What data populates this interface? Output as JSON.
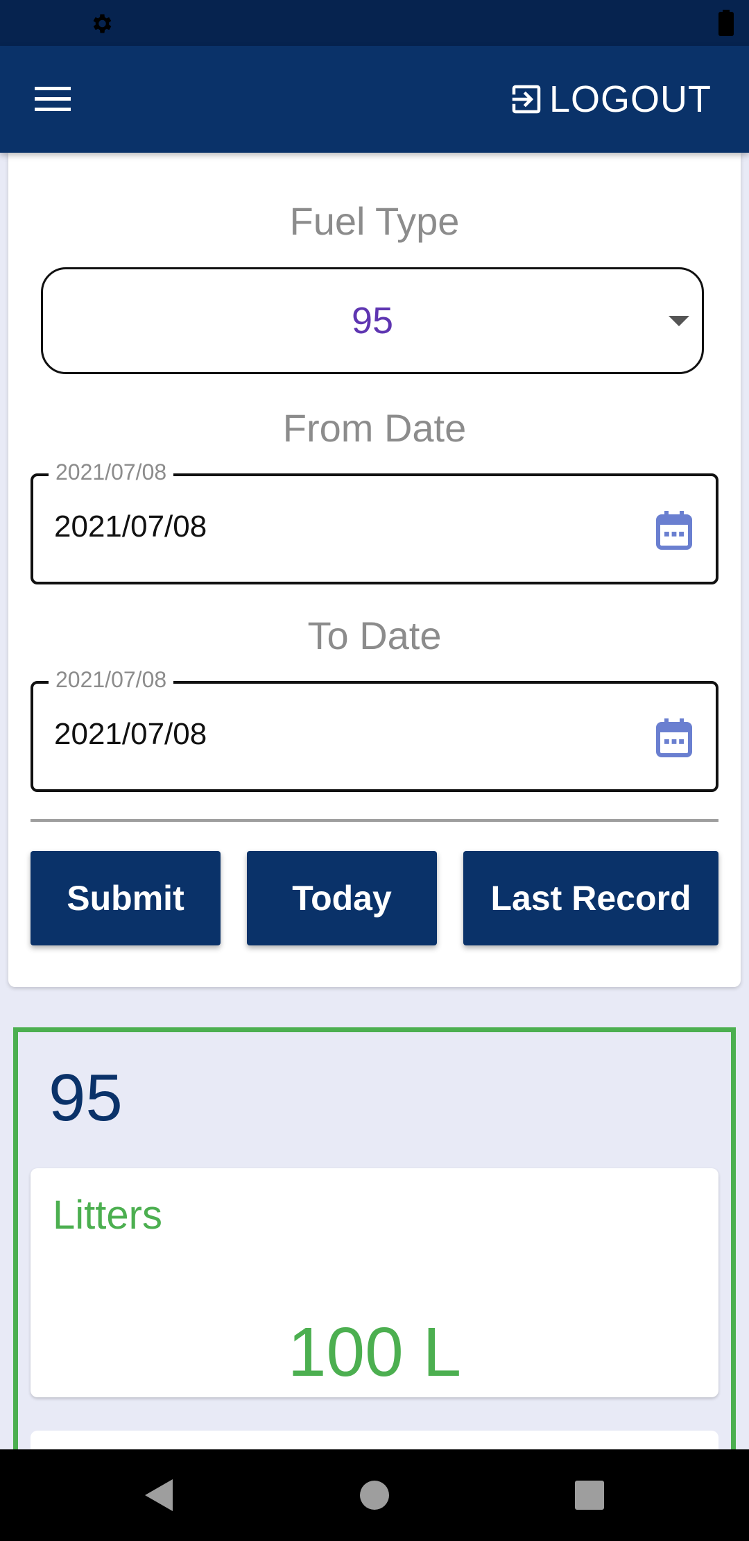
{
  "status_bar": {
    "icons": [
      "gear-icon",
      "battery-icon"
    ]
  },
  "app_bar": {
    "menu_icon": "hamburger-menu-icon",
    "logout_icon": "login-arrow-icon",
    "logout_label": "LOGOUT"
  },
  "filters": {
    "fuel_type_label": "Fuel Type",
    "fuel_type_value": "95",
    "from_date_label": "From Date",
    "from_date_legend": "2021/07/08",
    "from_date_value": "2021/07/08",
    "to_date_label": "To Date",
    "to_date_legend": "2021/07/08",
    "to_date_value": "2021/07/08",
    "calendar_icon": "calendar-icon"
  },
  "actions": {
    "submit_label": "Submit",
    "today_label": "Today",
    "last_record_label": "Last Record"
  },
  "result": {
    "title": "95",
    "metric_label": "Litters",
    "metric_value": "100 L"
  },
  "nav_bar": {
    "icons": [
      "back-icon",
      "home-icon",
      "recents-icon"
    ]
  },
  "colors": {
    "primary": "#0a3269",
    "status_bar": "#06234f",
    "accent_green": "#4caf50",
    "select_value": "#5e35b1",
    "calendar_icon": "#6a7fd0",
    "background": "#e8eaf6"
  }
}
